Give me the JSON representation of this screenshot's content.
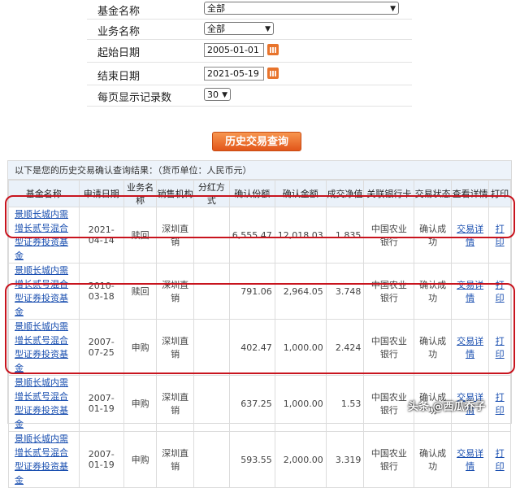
{
  "form": {
    "fund_name_label": "基金名称",
    "fund_name_value": "全部",
    "biz_name_label": "业务名称",
    "biz_name_value": "全部",
    "start_date_label": "起始日期",
    "start_date_value": "2005-01-01",
    "end_date_label": "结束日期",
    "end_date_value": "2021-05-19",
    "page_size_label": "每页显示记录数",
    "page_size_value": "30"
  },
  "query_button": "历史交易查询",
  "results": {
    "title": "以下是您的历史交易确认查询结果：（货币单位：人民币元）",
    "headers": [
      "基金名称",
      "申请日期",
      "业务名称",
      "销售机构",
      "分红方式",
      "确认份额",
      "确认金额",
      "成交净值",
      "关联银行卡",
      "交易状态",
      "查看详情",
      "打印"
    ],
    "rows": [
      {
        "fund": "景顺长城内需增长贰号混合型证券投资基金",
        "date": "2021-04-14",
        "biz": "赎回",
        "agency": "深圳直销",
        "dividend": "",
        "shares": "6,555.47",
        "amount": "12,018.03",
        "nav": "1.835",
        "bank": "中国农业银行",
        "status": "确认成功",
        "detail": "交易详情",
        "print": "打印"
      },
      {
        "fund": "景顺长城内需增长贰号混合型证券投资基金",
        "date": "2010-03-18",
        "biz": "赎回",
        "agency": "深圳直销",
        "dividend": "",
        "shares": "791.06",
        "amount": "2,964.05",
        "nav": "3.748",
        "bank": "中国农业银行",
        "status": "确认成功",
        "detail": "交易详情",
        "print": "打印"
      },
      {
        "fund": "景顺长城内需增长贰号混合型证券投资基金",
        "date": "2007-07-25",
        "biz": "申购",
        "agency": "深圳直销",
        "dividend": "",
        "shares": "402.47",
        "amount": "1,000.00",
        "nav": "2.424",
        "bank": "中国农业银行",
        "status": "确认成功",
        "detail": "交易详情",
        "print": "打印"
      },
      {
        "fund": "景顺长城内需增长贰号混合型证券投资基金",
        "date": "2007-01-19",
        "biz": "申购",
        "agency": "深圳直销",
        "dividend": "",
        "shares": "637.25",
        "amount": "1,000.00",
        "nav": "1.53",
        "bank": "中国农业银行",
        "status": "确认成功",
        "detail": "交易详情",
        "print": "打印"
      },
      {
        "fund": "景顺长城内需增长贰号混合型证券投资基金",
        "date": "2007-01-19",
        "biz": "申购",
        "agency": "深圳直销",
        "dividend": "",
        "shares": "593.55",
        "amount": "2,000.00",
        "nav": "3.319",
        "bank": "中国农业银行",
        "status": "确认成功",
        "detail": "交易详情",
        "print": "打印"
      }
    ]
  },
  "watermark": "头条 @西瓜乔子",
  "colors": {
    "highlight": "#c8141e",
    "button": "#e8742c",
    "link": "#1a4fb0",
    "header_bg": "#eaf1f9"
  }
}
